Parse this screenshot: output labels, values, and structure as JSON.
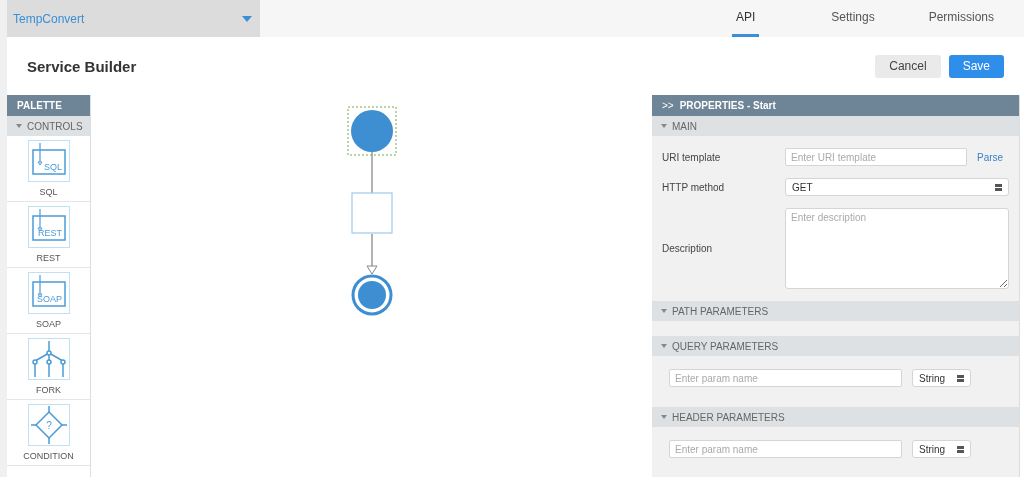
{
  "app_selector": {
    "value": "TempConvert"
  },
  "tabs": [
    {
      "label": "API",
      "selected": true
    },
    {
      "label": "Settings",
      "selected": false
    },
    {
      "label": "Permissions",
      "selected": false
    }
  ],
  "page_title": "Service Builder",
  "buttons": [
    {
      "label": "Cancel",
      "kind": "secondary"
    },
    {
      "label": "Save",
      "kind": "primary"
    }
  ],
  "palette": {
    "title": "PALETTE",
    "section": {
      "label": "CONTROLS",
      "expanded": true
    },
    "items": [
      {
        "label": "SQL",
        "kind": "task",
        "icon_text": "SQL"
      },
      {
        "label": "REST",
        "kind": "task",
        "icon_text": "REST"
      },
      {
        "label": "SOAP",
        "kind": "task",
        "icon_text": "SOAP"
      },
      {
        "label": "FORK",
        "kind": "fork"
      },
      {
        "label": "CONDITION",
        "kind": "condition",
        "icon_text": "?"
      }
    ]
  },
  "diagram": {
    "nodes": [
      {
        "kind": "start",
        "selected": true
      },
      {
        "kind": "task",
        "selected": false
      },
      {
        "kind": "end",
        "selected": false
      }
    ]
  },
  "properties": {
    "collapse_glyph": ">>",
    "title": "PROPERTIES - Start",
    "sections": [
      {
        "label": "MAIN",
        "expanded": true,
        "kind": "form",
        "fields": [
          {
            "kind": "text",
            "label": "URI template",
            "placeholder": "Enter URI template",
            "action": "Parse"
          },
          {
            "kind": "select",
            "label": "HTTP method",
            "value": "GET"
          },
          {
            "kind": "textarea",
            "label": "Description",
            "placeholder": "Enter description"
          }
        ]
      },
      {
        "label": "PATH PARAMETERS",
        "expanded": true,
        "kind": "empty"
      },
      {
        "label": "QUERY PARAMETERS",
        "expanded": true,
        "kind": "params",
        "placeholder": "Enter param name",
        "type_value": "String"
      },
      {
        "label": "HEADER PARAMETERS",
        "expanded": true,
        "kind": "params",
        "placeholder": "Enter param name",
        "type_value": "String"
      }
    ]
  }
}
